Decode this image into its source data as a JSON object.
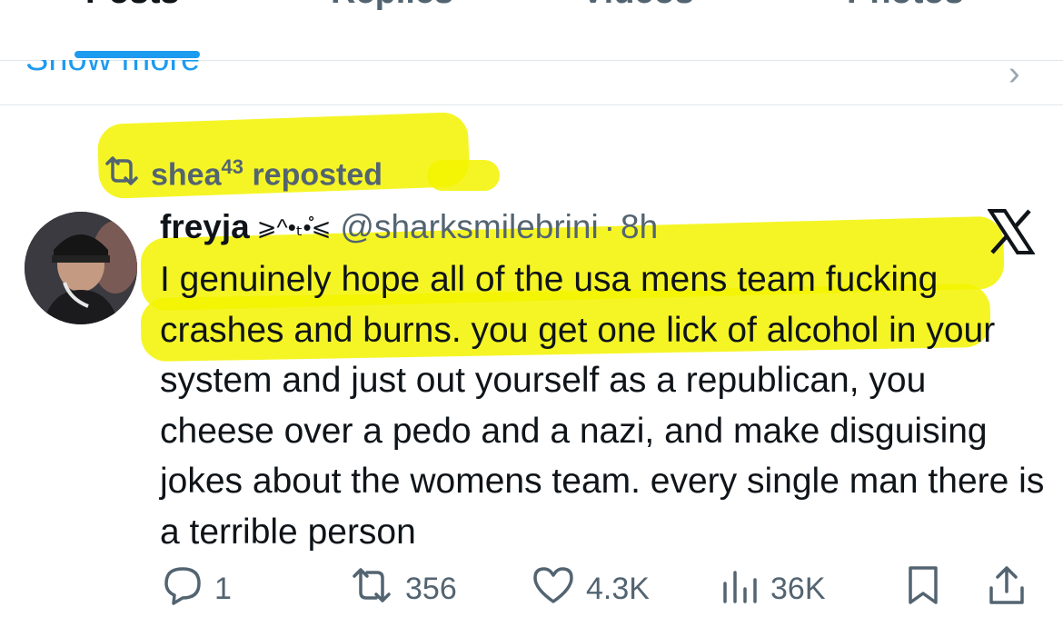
{
  "tabs": [
    {
      "label": "Posts",
      "active": true
    },
    {
      "label": "Replies",
      "active": false
    },
    {
      "label": "Videos",
      "active": false
    },
    {
      "label": "Photos",
      "active": false
    }
  ],
  "show_more": {
    "label": "Show more"
  },
  "repost": {
    "user": "shea",
    "superscript": "43",
    "text": "reposted"
  },
  "tweet": {
    "display_name": "freyja",
    "name_decoration": "⩾^•ₜ•̊̊⩽",
    "handle": "@sharksmilebrini",
    "separator": "·",
    "time": "8h",
    "text": "I genuinely hope all of the usa mens team fucking crashes and burns. you get one lick of alcohol in your system and just out yourself as a republican, you cheese over a pedo and a nazi, and make disguising jokes about the womens team. every single man there is a terrible person"
  },
  "actions": {
    "replies": "1",
    "reposts": "356",
    "likes": "4.3K",
    "views": "36K"
  },
  "colors": {
    "accent": "#1d9bf0",
    "muted_text": "#536471",
    "highlighter": "#f3f300"
  },
  "icons": [
    "repost-icon",
    "x-logo-icon",
    "reply-icon",
    "like-icon",
    "views-icon",
    "bookmark-icon",
    "share-icon",
    "chevron-right-icon"
  ]
}
